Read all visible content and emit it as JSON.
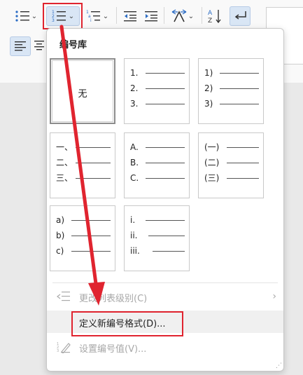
{
  "ribbon": {
    "bullets_icon": "bullet-list-icon",
    "numbering_icon": "numbered-list-icon",
    "multilevel_icon": "multilevel-list-icon",
    "decrease_indent_icon": "decrease-indent-icon",
    "increase_indent_icon": "increase-indent-icon",
    "sort_icon": "sort-icon",
    "marks_icon": "show-marks-icon",
    "align_left_icon": "align-left-icon"
  },
  "menu": {
    "title": "编号库",
    "library": [
      {
        "type": "none",
        "label": "无"
      },
      {
        "type": "list",
        "rows": [
          "1.",
          "2.",
          "3."
        ]
      },
      {
        "type": "list",
        "rows": [
          "1)",
          "2)",
          "3)"
        ]
      },
      {
        "type": "list",
        "rows": [
          "一、",
          "二、",
          "三、"
        ]
      },
      {
        "type": "list",
        "rows": [
          "A.",
          "B.",
          "C."
        ]
      },
      {
        "type": "list",
        "rows": [
          "(一)",
          "(二)",
          "(三)"
        ]
      },
      {
        "type": "list",
        "rows": [
          "a)",
          "b)",
          "c)"
        ]
      },
      {
        "type": "list",
        "rows": [
          "i.",
          "ii.",
          "iii."
        ]
      }
    ],
    "change_level": "更改列表级别(C)",
    "define_new": "定义新编号格式(D)...",
    "set_value": "设置编号值(V)..."
  },
  "colors": {
    "annotation_red": "#e0242f",
    "selection": "#8c8c8c"
  }
}
